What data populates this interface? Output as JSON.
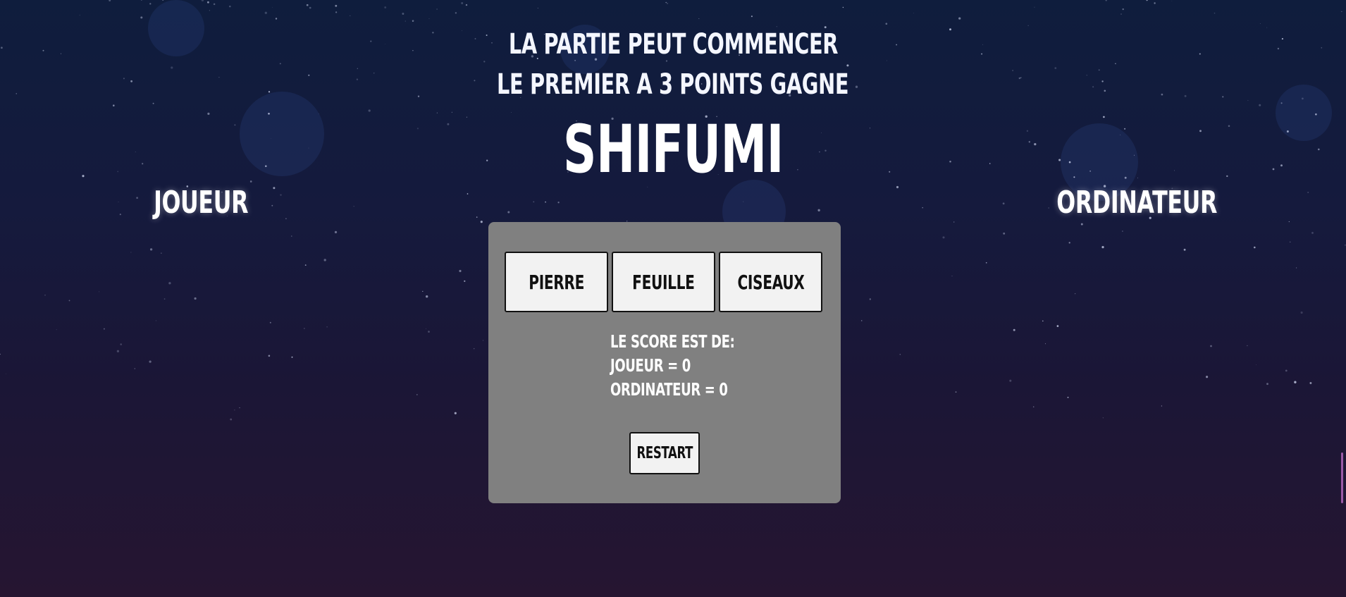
{
  "header": {
    "line1": "LA PARTIE PEUT COMMENCER",
    "line2": "LE PREMIER A 3 POINTS GAGNE",
    "title": "SHIFUMI"
  },
  "labels": {
    "player": "JOUEUR",
    "computer": "ORDINATEUR"
  },
  "choices": {
    "rock": "PIERRE",
    "paper": "FEUILLE",
    "scissors": "CISEAUX"
  },
  "score": {
    "heading": "LE SCORE EST DE:",
    "player_line": "JOUEUR = 0",
    "computer_line": "ORDINATEUR = 0"
  },
  "restart_label": "RESTART",
  "colors": {
    "panel": "#808080",
    "button": "#f2f2f2",
    "text": "#ffffff",
    "accent": "#9b5aa6"
  }
}
